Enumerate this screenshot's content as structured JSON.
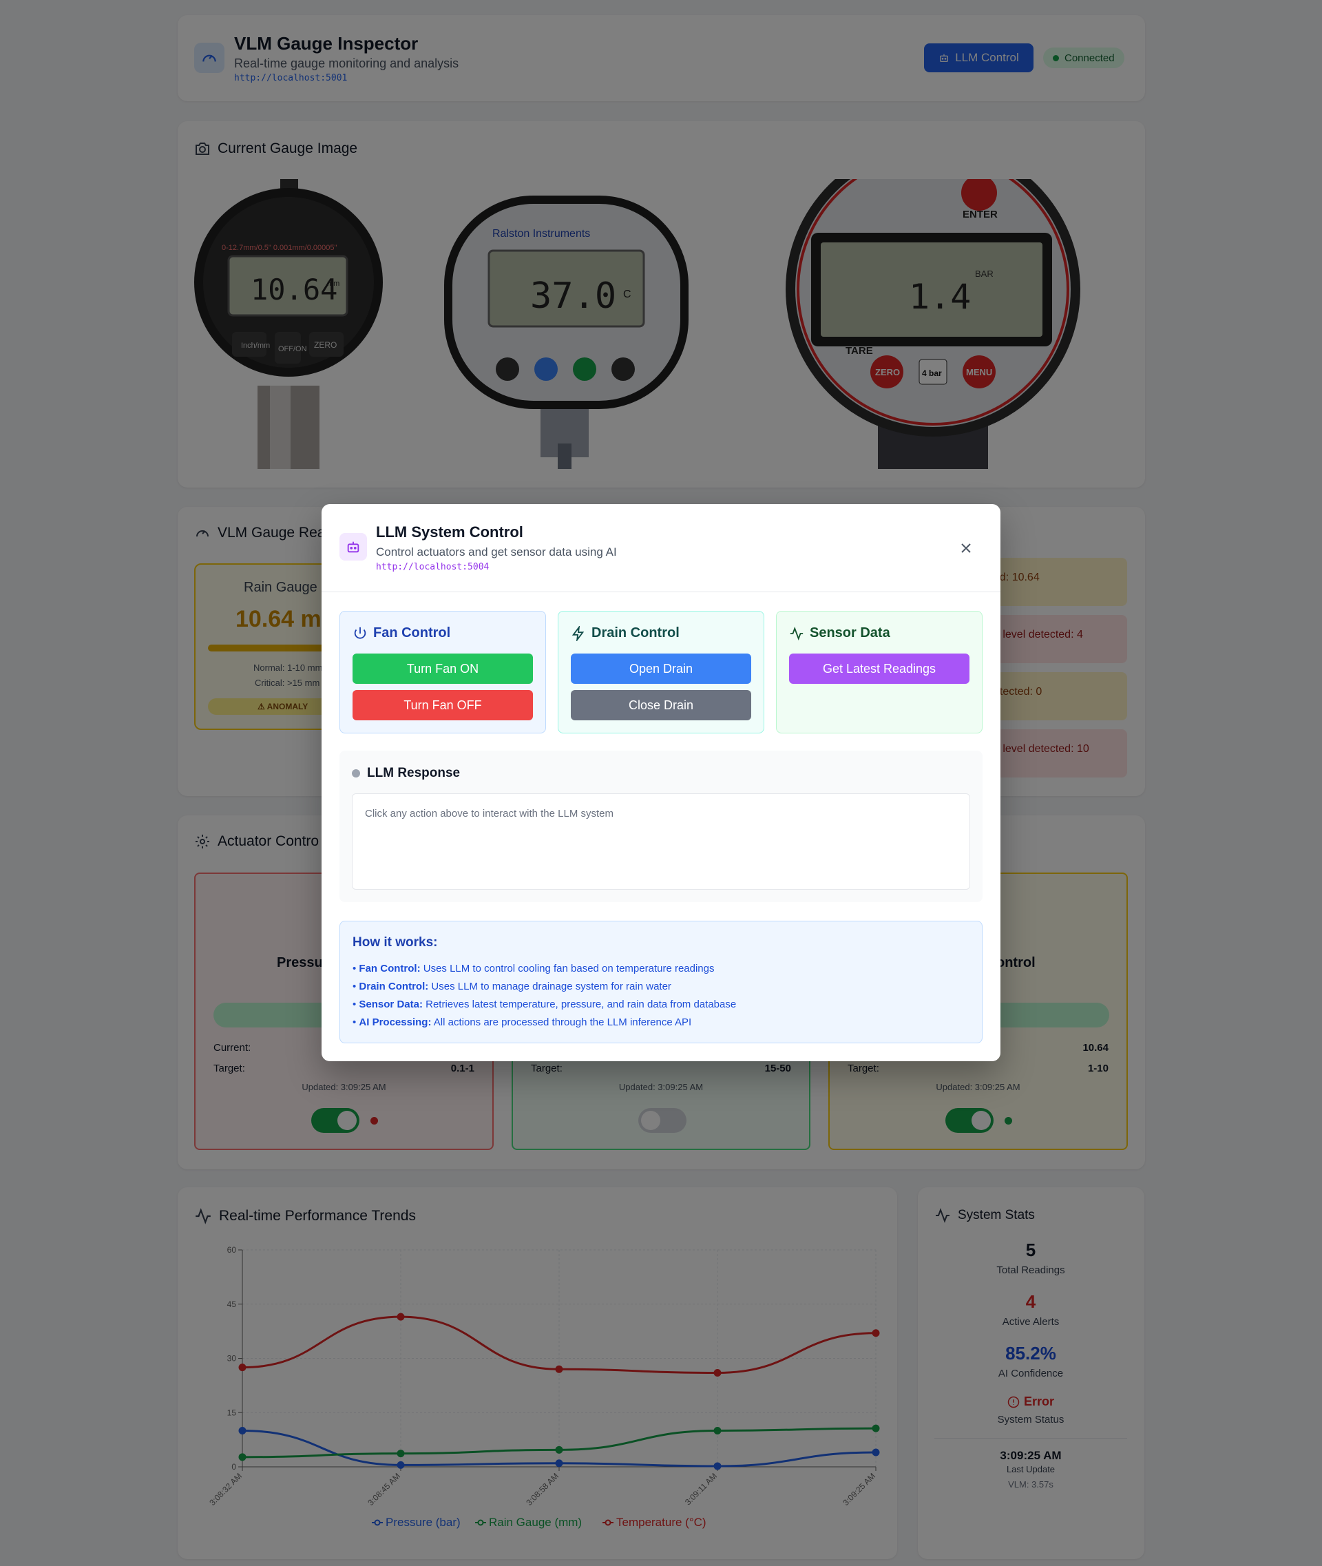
{
  "header": {
    "title": "VLM Gauge Inspector",
    "subtitle": "Real-time gauge monitoring and analysis",
    "url": "http://localhost:5001",
    "llm_button": "LLM Control",
    "status": "Connected"
  },
  "gauge_image_section": {
    "title": "Current Gauge Image",
    "gauges": [
      {
        "display": "10.64",
        "unit": "mm",
        "top_text": "0-12.7mm/0.5\"   0.001mm/0.00005\"",
        "buttons": [
          "Inch/mm",
          "OFF/ON",
          "ZERO"
        ]
      },
      {
        "display": "37.0",
        "unit": "C",
        "brand": "Ralston Instruments"
      },
      {
        "display": "1.4",
        "unit": "BAR",
        "labels": [
          "ENTER",
          "TARE",
          "ZERO",
          "4 bar",
          "MENU"
        ]
      }
    ]
  },
  "readings_section": {
    "title": "VLM Gauge Rea",
    "card": {
      "name": "Rain Gauge",
      "value": "10.64 m",
      "normal": "Normal: 1-10 mm",
      "critical": "Critical: >15 mm",
      "badge": "ANOMALY"
    },
    "alerts": [
      {
        "text": "ed: 10.64",
        "color": "#fef3c7"
      },
      {
        "text": "e level detected: 4",
        "color": "#fee2e2"
      },
      {
        "text": "etected: 0",
        "color": "#fef3c7"
      },
      {
        "text": "e level detected: 10",
        "color": "#fee2e2"
      }
    ]
  },
  "actuator_section": {
    "title": "Actuator Contro",
    "cards": [
      {
        "title": "Pressu",
        "current_label": "Current:",
        "current": "",
        "target_label": "Target:",
        "target": "0.1-1",
        "updated": "Updated: 3:09:25 AM",
        "toggle_on": true,
        "indicator_color": "#dc2626"
      },
      {
        "title": "",
        "current_label": "",
        "current": "",
        "target_label": "Target:",
        "target": "15-50",
        "updated": "Updated: 3:09:25 AM",
        "toggle_on": false,
        "indicator_color": ""
      },
      {
        "title": "ontrol",
        "current_label": "",
        "current": "10.64",
        "target_label": "Target:",
        "target": "1-10",
        "updated": "Updated: 3:09:25 AM",
        "toggle_on": true,
        "indicator_color": "#16a34a"
      }
    ]
  },
  "trends": {
    "title": "Real-time Performance Trends"
  },
  "chart_data": {
    "type": "line",
    "categories": [
      "3:08:32 AM",
      "3:08:45 AM",
      "3:08:58 AM",
      "3:09:11 AM",
      "3:09:25 AM"
    ],
    "series": [
      {
        "name": "Pressure (bar)",
        "color": "#2563eb",
        "values": [
          10,
          0.5,
          1,
          0.2,
          4
        ]
      },
      {
        "name": "Rain Gauge (mm)",
        "color": "#16a34a",
        "values": [
          2.7,
          3.7,
          4.7,
          10,
          10.64
        ]
      },
      {
        "name": "Temperature (°C)",
        "color": "#dc2626",
        "values": [
          27.5,
          41.5,
          27,
          26,
          37
        ]
      }
    ],
    "y_ticks": [
      "0",
      "15",
      "30",
      "45",
      "60"
    ],
    "ylim": [
      0,
      60
    ],
    "grid": true,
    "legend_placement": "bottom"
  },
  "stats": {
    "title": "System Stats",
    "total_readings": "5",
    "total_readings_label": "Total Readings",
    "active_alerts": "4",
    "active_alerts_label": "Active Alerts",
    "ai_confidence": "85.2%",
    "ai_confidence_label": "AI Confidence",
    "system_status": "Error",
    "system_status_label": "System Status",
    "last_update": "3:09:25 AM",
    "last_update_label": "Last Update",
    "vlm_time": "VLM: 3.57s"
  },
  "modal": {
    "title": "LLM System Control",
    "subtitle": "Control actuators and get sensor data using AI",
    "url": "http://localhost:5004",
    "fan": {
      "title": "Fan Control",
      "on": "Turn Fan ON",
      "off": "Turn Fan OFF"
    },
    "drain": {
      "title": "Drain Control",
      "open": "Open Drain",
      "close": "Close Drain"
    },
    "sensor": {
      "title": "Sensor Data",
      "button": "Get Latest Readings"
    },
    "response": {
      "title": "LLM Response",
      "placeholder": "Click any action above to interact with the LLM system"
    },
    "how": {
      "title": "How it works:",
      "items": [
        {
          "label": "Fan Control:",
          "text": " Uses LLM to control cooling fan based on temperature readings"
        },
        {
          "label": "Drain Control:",
          "text": " Uses LLM to manage drainage system for rain water"
        },
        {
          "label": "Sensor Data:",
          "text": " Retrieves latest temperature, pressure, and rain data from database"
        },
        {
          "label": "AI Processing:",
          "text": " All actions are processed through the LLM inference API"
        }
      ]
    }
  }
}
